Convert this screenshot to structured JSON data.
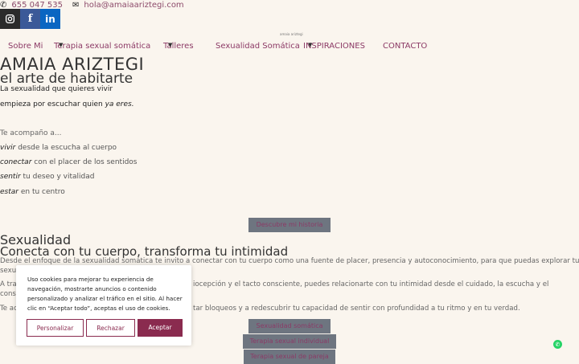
{
  "topbar": {
    "phone": "655 047 535",
    "email": "hola@amaiaariztegi.com"
  },
  "tiny_text": "amaia ariztegi",
  "nav": {
    "items": [
      {
        "label": "Sobre Mi"
      },
      {
        "label": "Terapia sexual somática"
      },
      {
        "label": "Talleres"
      },
      {
        "label": "Sexualidad Somática"
      },
      {
        "label": "INSPIRACIONES"
      },
      {
        "label": "CONTACTO"
      }
    ]
  },
  "hero": {
    "title": "AMAIA ARIZTEGI",
    "subtitle": "el arte de habitarte",
    "line1": "La sexualidad que quieres vivir",
    "line2_a": "empieza por escuchar quien ",
    "line2_b": "ya eres.",
    "intro": "Te acompaño a...",
    "items": [
      {
        "verb": "vivir",
        "rest": " desde la escucha al cuerpo"
      },
      {
        "verb": "conectar",
        "rest": " con el placer de los sentidos"
      },
      {
        "verb": "sentir",
        "rest": " tu deseo y vitalidad"
      },
      {
        "verb": "estar",
        "rest": " en tu centro"
      }
    ],
    "button": "Descubre mi historia"
  },
  "section2": {
    "title": "Sexualidad",
    "subtitle": "Conecta con tu cuerpo, transforma tu intimidad",
    "p1": "Desde el enfoque de la sexualidad somática te invito a conectar con tu cuerpo como una fuente de placer, presencia y autoconocimiento, para que puedas explorar tu",
    "p1b": "sexu",
    "p2": "A tra",
    "p2_rest": "iocepción y el tacto consciente, puedes relacionarte con tu intimidad desde el cuidado, la escucha y el",
    "p2b": "cons",
    "p3": "Te ac",
    "p3_rest": "tar bloqueos y a redescubrir tu capacidad de sentir con profundidad a tu ritmo y en tu verdad.",
    "buttons": [
      "Sexualidad somática",
      "Terapia sexual individual",
      "Terapia sexual de pareja"
    ]
  },
  "cookie": {
    "text": "Uso cookies para mejorar tu experiencia de navegación, mostrarte anuncios o contenido personalizado y analizar el tráfico en el sitio. Al hacer clic en “Aceptar todo”, aceptas el uso de cookies.",
    "customize": "Personalizar",
    "reject": "Rechazar",
    "accept": "Aceptar"
  },
  "colors": {
    "accent": "#8c3a66",
    "accept_bg": "#8a2b4f",
    "button_gray": "#6e7580",
    "bg": "#faf5ee"
  }
}
